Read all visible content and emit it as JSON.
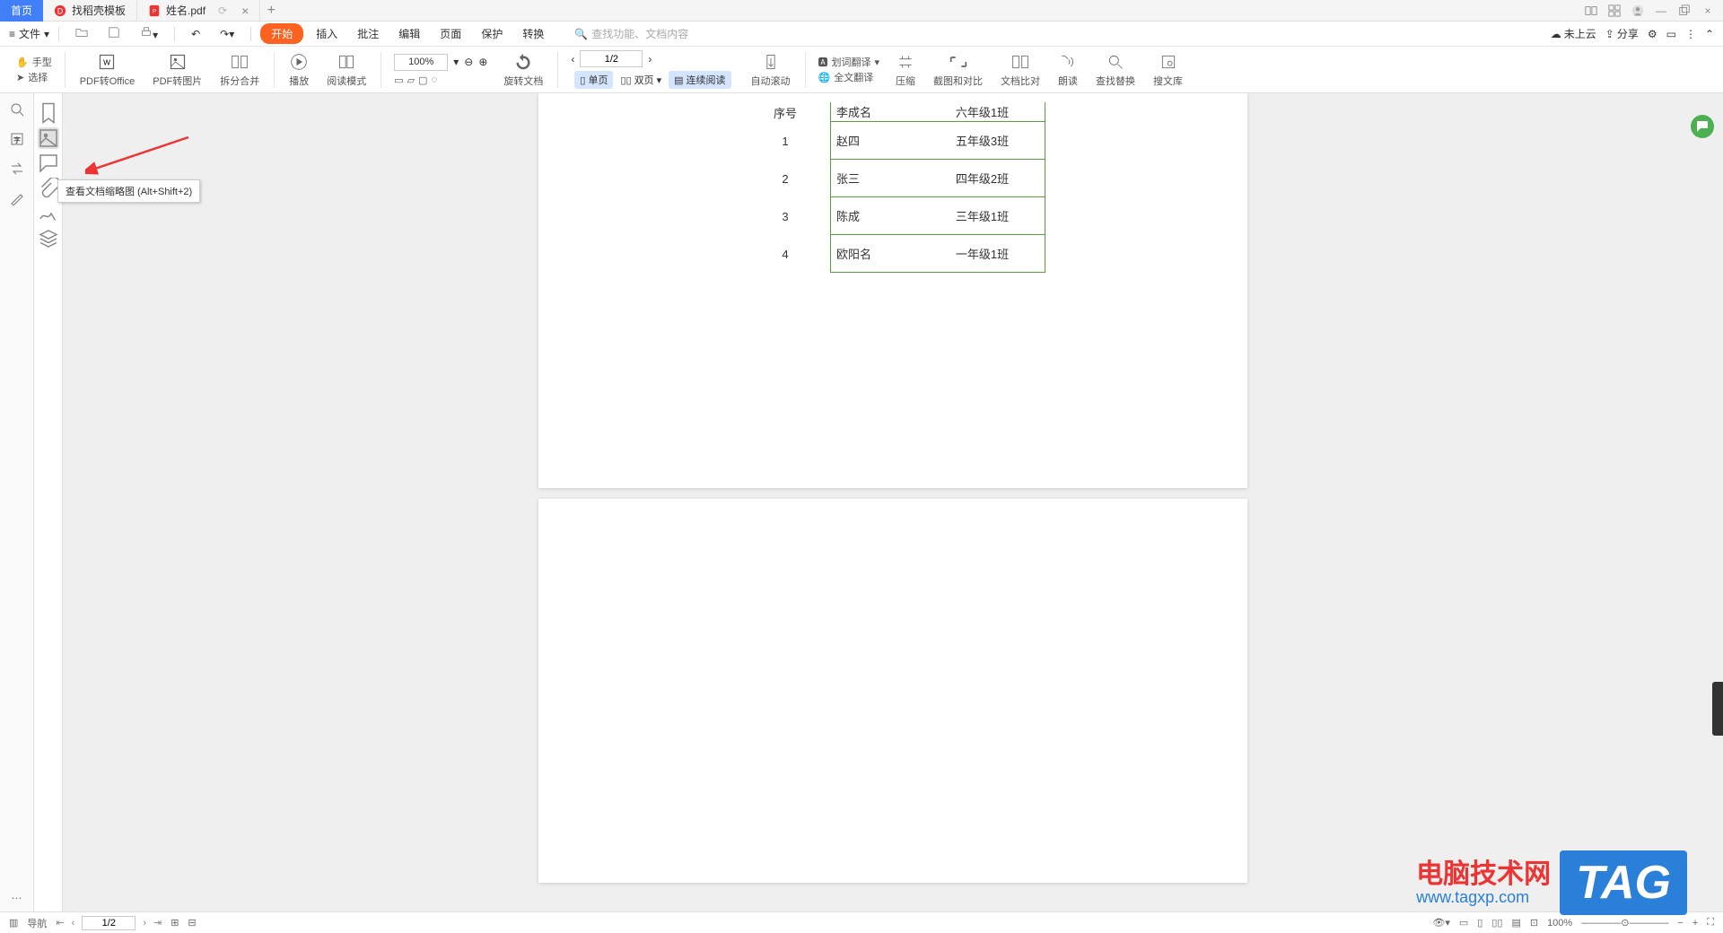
{
  "tabs": {
    "home": "首页",
    "t1": "找稻壳模板",
    "t2": "姓名.pdf"
  },
  "menu": {
    "file": "文件",
    "start": "开始",
    "insert": "插入",
    "annotate": "批注",
    "edit": "编辑",
    "page": "页面",
    "protect": "保护",
    "convert": "转换",
    "searchPlaceholder": "查找功能、文档内容",
    "notUploaded": "未上云",
    "share": "分享"
  },
  "ribbon": {
    "hand": "手型",
    "select": "选择",
    "pdfOffice": "PDF转Office",
    "pdfImage": "PDF转图片",
    "splitMerge": "拆分合并",
    "play": "播放",
    "readMode": "阅读模式",
    "zoom": "100%",
    "rotate": "旋转文档",
    "pageNav": "1/2",
    "single": "单页",
    "double": "双页",
    "contRead": "连续阅读",
    "autoScroll": "自动滚动",
    "wordTrans": "划词翻译",
    "fullTrans": "全文翻译",
    "compress": "压缩",
    "screenshot": "截图和对比",
    "compare": "文档比对",
    "read": "朗读",
    "findReplace": "查找替换",
    "searchLib": "搜文库"
  },
  "tooltip": "查看文档缩略图 (Alt+Shift+2)",
  "table": {
    "h1": "序号",
    "h2": "李成名",
    "h3": "六年级1班",
    "rows": [
      {
        "n": "1",
        "name": "赵四",
        "cls": "五年级3班"
      },
      {
        "n": "2",
        "name": "张三",
        "cls": "四年级2班"
      },
      {
        "n": "3",
        "name": "陈成",
        "cls": "三年级1班"
      },
      {
        "n": "4",
        "name": "欧阳名",
        "cls": "一年级1班"
      }
    ]
  },
  "status": {
    "nav": "导航",
    "page": "1/2",
    "zoom": "100%"
  },
  "watermark": {
    "site": "电脑技术网",
    "url": "www.tagxp.com",
    "tag": "TAG"
  }
}
